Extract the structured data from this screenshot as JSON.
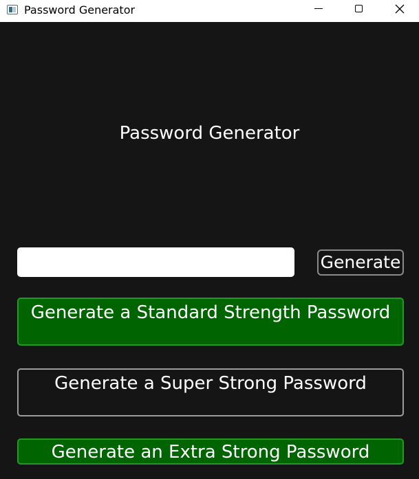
{
  "window": {
    "title": "Password Generator",
    "controls": {
      "minimize": "minimize-icon",
      "maximize": "maximize-icon",
      "close": "close-icon"
    }
  },
  "main": {
    "heading": "Password Generator",
    "password_field": {
      "value": "",
      "placeholder": ""
    },
    "generate_label": "Generate",
    "standard_label": "Generate a Standard Strength Password",
    "super_label": "Generate a Super Strong Password",
    "extra_label": "Generate an Extra Strong Password"
  },
  "colors": {
    "background": "#151515",
    "green_button": "#006400",
    "green_border": "#1f9a24",
    "text": "#ffffff"
  }
}
